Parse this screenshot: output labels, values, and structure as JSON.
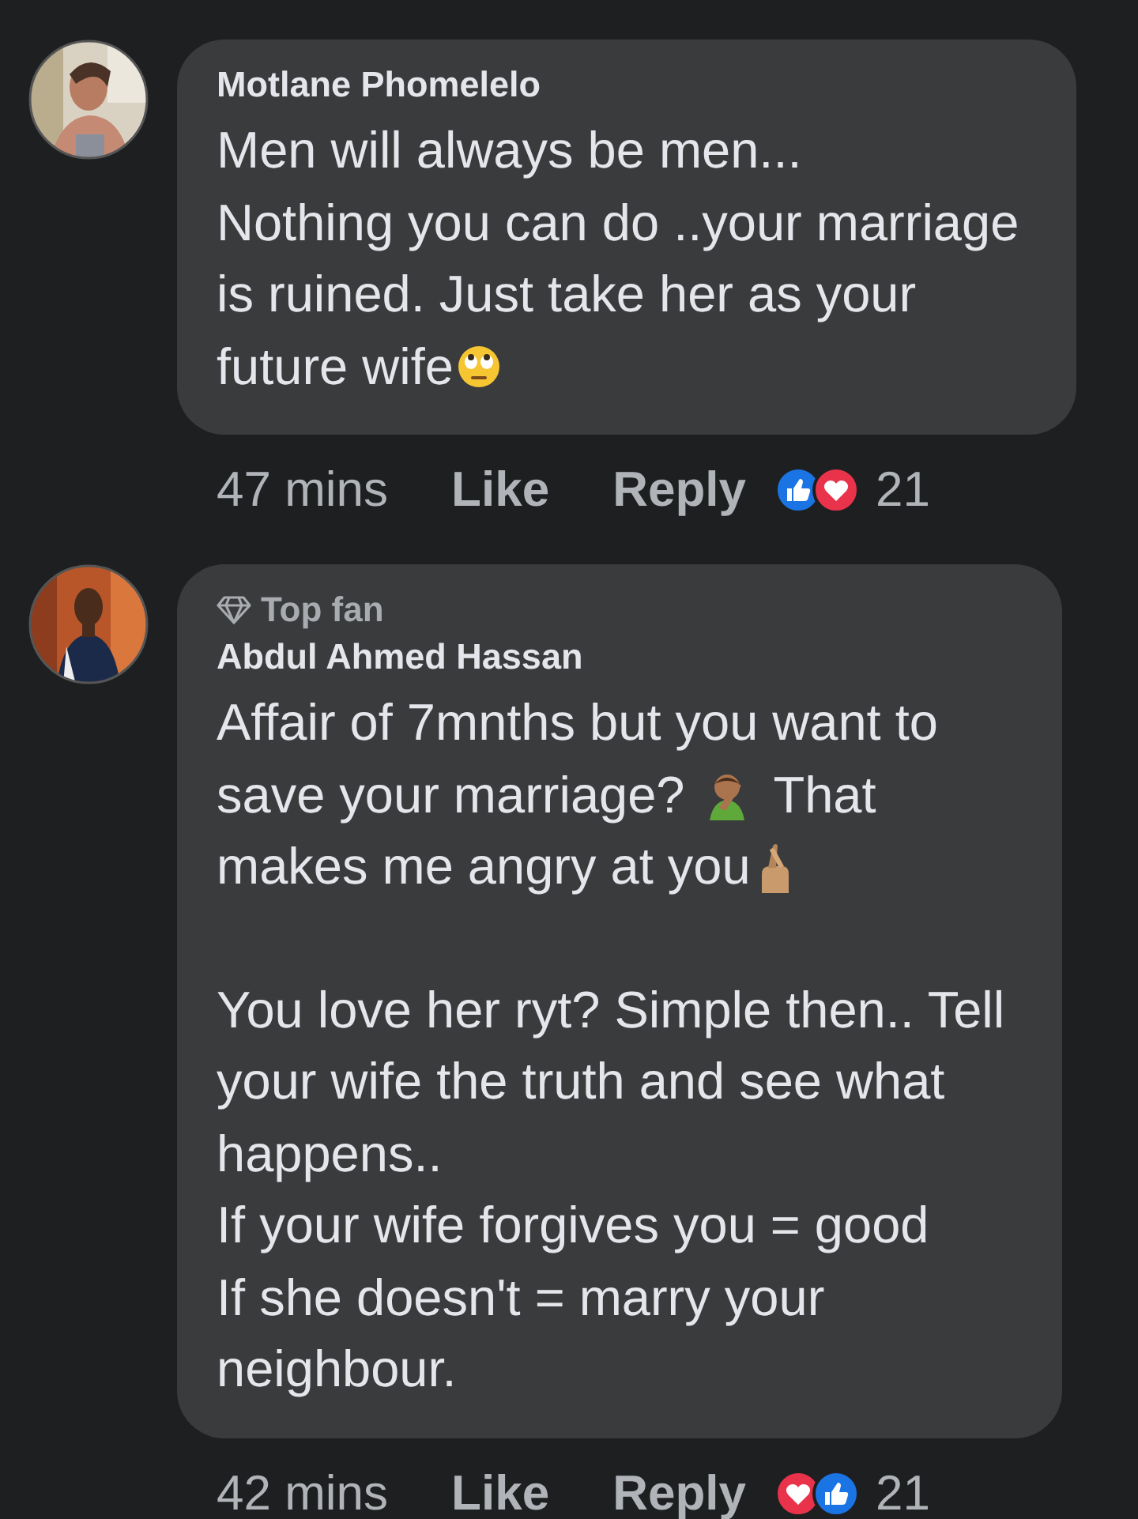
{
  "comments": [
    {
      "author": "Motlane Phomelelo",
      "avatar": {
        "kind": "picture"
      },
      "paragraphs": [
        {
          "lines": [
            {
              "text": "Men will always be men..."
            },
            {
              "text": "Nothing you can do ..your marriage"
            },
            {
              "text": "is ruined. Just take her as your"
            },
            {
              "text": "future wife",
              "emoji": {
                "kind": "eye-roll"
              }
            }
          ]
        }
      ],
      "time": "47 mins",
      "like": "Like",
      "reply": "Reply",
      "reactions": [
        {
          "kind": "like"
        },
        {
          "kind": "love"
        }
      ],
      "reaction_count": "21"
    },
    {
      "badge": "Top fan",
      "author": "Abdul Ahmed Hassan",
      "avatar": {
        "kind": "picture"
      },
      "paragraphs": [
        {
          "lines": [
            {
              "text": "Affair of 7mnths but you want to"
            },
            {
              "text": "save your marriage?",
              "emoji": {
                "kind": "facepalm"
              },
              "after": "That"
            },
            {
              "text": "makes me angry at you",
              "emoji": {
                "kind": "crossed-fingers"
              }
            }
          ]
        },
        {
          "lines": [
            {
              "text": "You love her ryt? Simple then.. Tell"
            },
            {
              "text": "your wife the truth and see what"
            },
            {
              "text": "happens.."
            },
            {
              "text": "If your wife forgives you = good"
            },
            {
              "text": "If she doesn't = marry your"
            },
            {
              "text": "neighbour."
            }
          ]
        }
      ],
      "time": "42 mins",
      "like": "Like",
      "reply": "Reply",
      "reactions": [
        {
          "kind": "love"
        },
        {
          "kind": "like"
        }
      ],
      "reaction_count": "21"
    }
  ]
}
